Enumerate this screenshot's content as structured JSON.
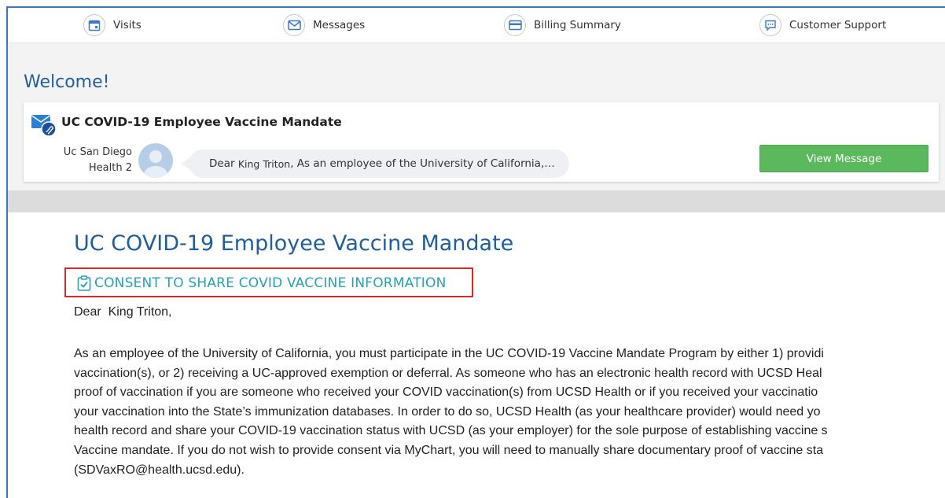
{
  "nav": {
    "items": [
      {
        "label": "Visits",
        "icon": "calendar-icon"
      },
      {
        "label": "Messages",
        "icon": "envelope-icon"
      },
      {
        "label": "Billing Summary",
        "icon": "credit-card-icon"
      },
      {
        "label": "Customer Support",
        "icon": "chat-icon"
      }
    ]
  },
  "welcome": "Welcome!",
  "message": {
    "subject": "UC COVID-19 Employee Vaccine Mandate",
    "sender_line1": "Uc San Diego",
    "sender_line2": "Health 2",
    "preview_prefix": "Dear",
    "preview_name": "King Triton",
    "preview_suffix": ", As an employee of the University of California,…",
    "view_button": "View Message"
  },
  "document": {
    "title": "UC COVID-19 Employee Vaccine Mandate",
    "consent_link": "CONSENT TO SHARE COVID VACCINE INFORMATION",
    "greeting": "Dear  King Triton,",
    "paragraph_lines": [
      "As an employee of the University of California, you must participate in the UC COVID-19 Vaccine Mandate Program by either 1) providi",
      "vaccination(s), or 2) receiving a UC-approved exemption or deferral.  As someone who has an electronic health record with UCSD Heal",
      "proof of vaccination if you are someone who received your COVID vaccination(s) from UCSD Health or if you received your vaccinatio",
      "your vaccination into the State’s immunization databases.  In order to do so, UCSD Health (as your healthcare provider) would need yo",
      "health record and share your COVID-19 vaccination status with UCSD (as your employer) for the sole purpose of establishing vaccine s",
      "Vaccine mandate. If you do not wish to provide consent via MyChart, you will need to manually share documentary proof of vaccine sta",
      "(SDVaxRO@health.ucsd.edu)."
    ]
  },
  "colors": {
    "frame_border": "#3b78c2",
    "title_blue": "#1f5f9e",
    "consent_teal": "#27a2b4",
    "highlight_red": "#d62a2a",
    "button_green": "#5cb85c"
  }
}
